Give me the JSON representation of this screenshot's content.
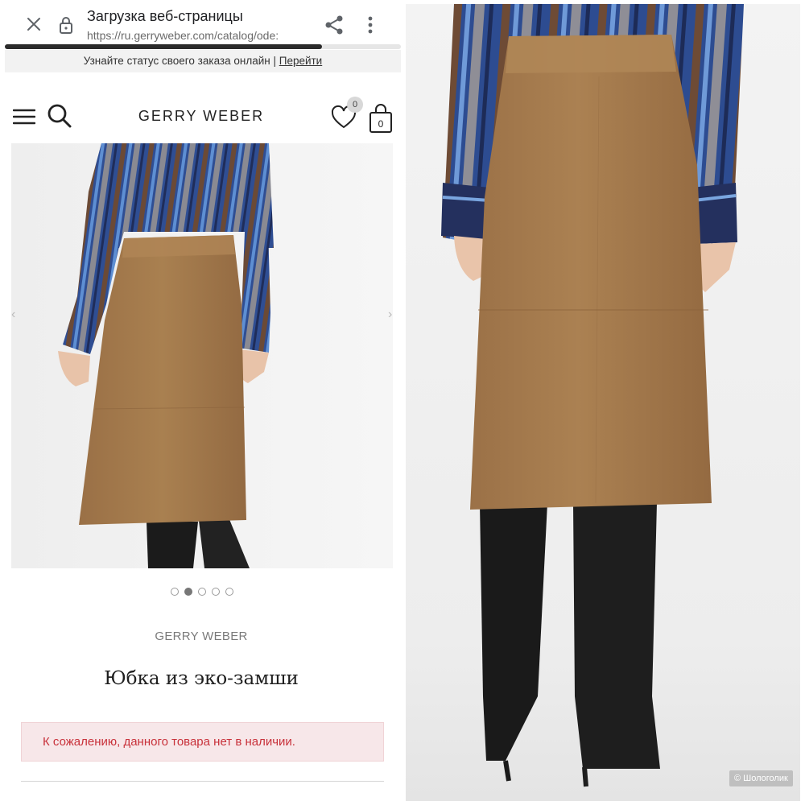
{
  "browser": {
    "title": "Загрузка веб-страницы",
    "url": "https://ru.gerryweber.com/catalog/ode:",
    "progress": 0.8,
    "icons": {
      "close": "close-icon",
      "lock": "lock-icon",
      "share": "share-icon",
      "more": "more-vertical-icon"
    }
  },
  "promo": {
    "text": "Узнайте статус своего заказа онлайн | ",
    "link": "Перейти"
  },
  "header": {
    "brand": "GERRY WEBER",
    "wishlist_count": "0",
    "cart_count": "0",
    "icons": {
      "menu": "hamburger-menu-icon",
      "search": "search-icon",
      "wishlist": "heart-icon",
      "cart": "shopping-bag-icon"
    }
  },
  "gallery": {
    "dots": 5,
    "active_index": 1,
    "prev": "‹",
    "next": "›"
  },
  "product": {
    "brand": "GERRY WEBER",
    "name": "Юбка из эко-замши",
    "stock_message": "К сожалению, данного товара нет в наличии."
  },
  "watermark": "© Шологолик",
  "colors": {
    "skirt": "#a47b4d",
    "shirt_blue": "#2e4b8f",
    "boots": "#1a1a1a",
    "alert_text": "#c8313a",
    "alert_bg": "#f7e7e9"
  }
}
